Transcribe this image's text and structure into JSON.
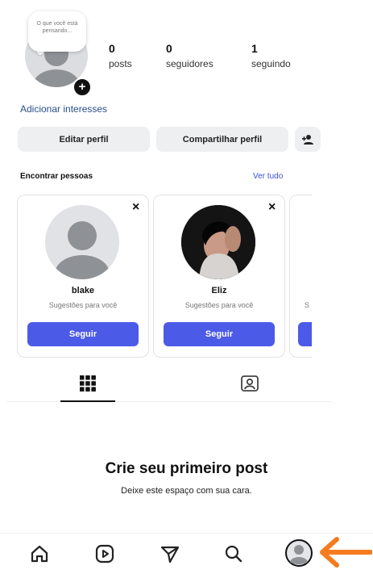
{
  "profile": {
    "note": "O que você está pensando...",
    "add_interests": "Adicionar interesses",
    "stats": [
      {
        "value": "0",
        "label": "posts"
      },
      {
        "value": "0",
        "label": "seguidores"
      },
      {
        "value": "1",
        "label": "seguindo"
      }
    ]
  },
  "actions": {
    "edit_profile": "Editar perfil",
    "share_profile": "Compartilhar perfil",
    "discover_icon": "add-person-icon"
  },
  "suggestions": {
    "title": "Encontrar pessoas",
    "see_all": "Ver tudo",
    "cards": [
      {
        "name": "blake",
        "subtitle": "Sugestões para você",
        "follow": "Seguir",
        "close": "×"
      },
      {
        "name": "Eliz",
        "subtitle": "Sugestões para você",
        "follow": "Seguir",
        "close": "×"
      },
      {
        "name": "",
        "subtitle": "S",
        "follow": "",
        "close": ""
      }
    ]
  },
  "tabs": [
    {
      "icon": "grid-icon",
      "active": true
    },
    {
      "icon": "tagged-icon",
      "active": false
    }
  ],
  "empty_state": {
    "title": "Crie seu primeiro post",
    "subtitle": "Deixe este espaço com sua cara."
  },
  "bottom_nav": [
    {
      "icon": "home-icon"
    },
    {
      "icon": "reels-icon"
    },
    {
      "icon": "send-icon"
    },
    {
      "icon": "search-icon"
    },
    {
      "icon": "profile-icon"
    }
  ],
  "colors": {
    "accent": "#4c5ae8",
    "link": "#2a4f8a",
    "arrow": "#f57c1f"
  }
}
